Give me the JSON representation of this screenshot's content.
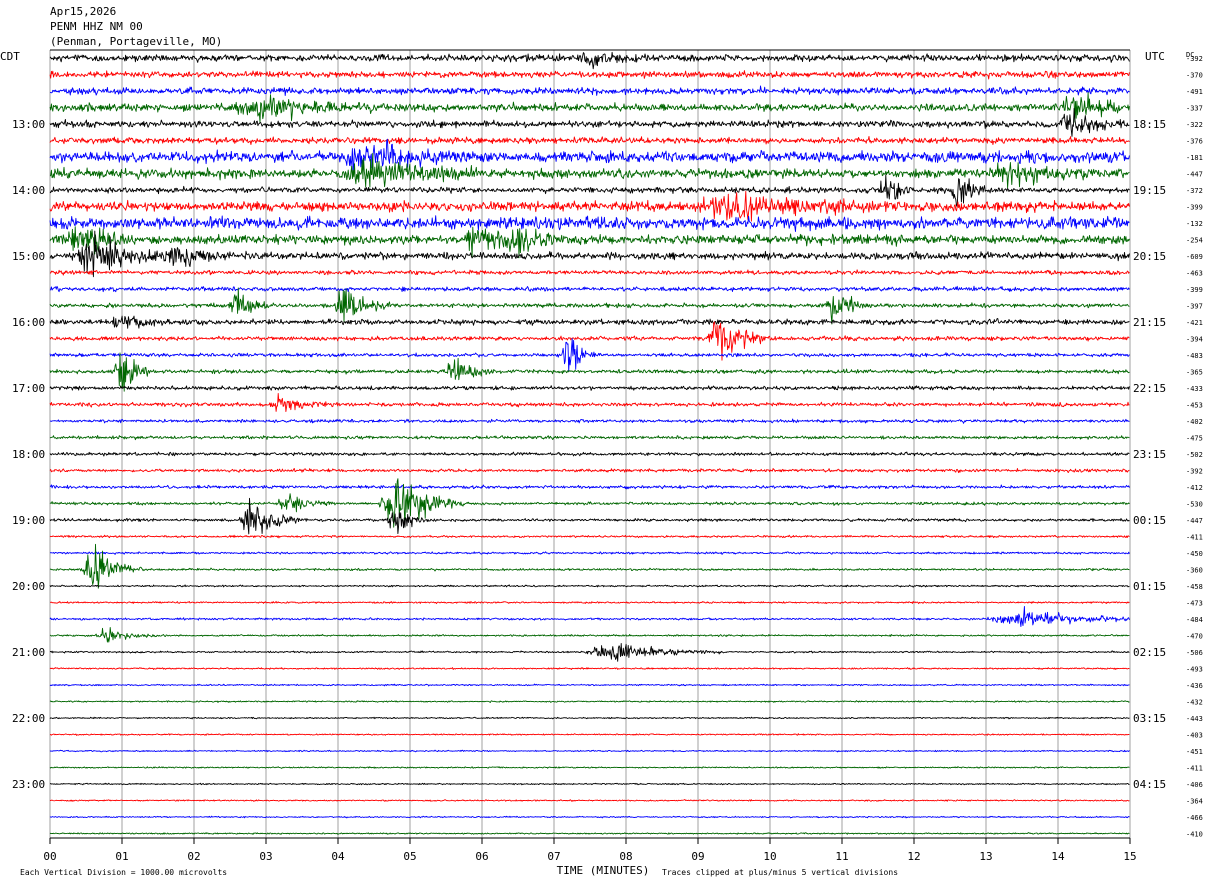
{
  "chart_data": {
    "type": "line",
    "header": {
      "date": "Apr15,2026",
      "station": "PENM HHZ NM 00",
      "location": "(Penman, Portageville, MO)"
    },
    "left_timezone": "CDT",
    "right_timezone": "UTC",
    "dc_label": "DC",
    "xlabel": "TIME (MINUTES)",
    "x_ticks": [
      "00",
      "01",
      "02",
      "03",
      "04",
      "05",
      "06",
      "07",
      "08",
      "09",
      "10",
      "11",
      "12",
      "13",
      "14",
      "15"
    ],
    "xlim": [
      0,
      15
    ],
    "minutes_per_trace": 15,
    "left_hour_labels": [
      "13:00",
      "14:00",
      "15:00",
      "16:00",
      "17:00",
      "18:00",
      "19:00",
      "20:00",
      "21:00",
      "22:00",
      "23:00"
    ],
    "right_hour_labels": [
      "18:15",
      "19:15",
      "20:15",
      "21:15",
      "22:15",
      "23:15",
      "00:15",
      "01:15",
      "02:15",
      "03:15",
      "04:15"
    ],
    "first_hour_label_trace_index": 4,
    "traces_per_hour": 4,
    "trace_colors": [
      "#000000",
      "#ff0000",
      "#0000ff",
      "#006600"
    ],
    "dc_offsets": [
      "-392",
      "-370",
      "-491",
      "-337",
      "-322",
      "-376",
      "-181",
      "-447",
      "-372",
      "-399",
      "-132",
      "-254",
      "-609",
      "-463",
      "-399",
      "-397",
      "-421",
      "-394",
      "-483",
      "-365",
      "-433",
      "-453",
      "-402",
      "-475",
      "-502",
      "-392",
      "-412",
      "-530",
      "-447",
      "-411",
      "-450",
      "-360",
      "-458",
      "-473",
      "-484",
      "-470",
      "-506",
      "-493",
      "-436",
      "-432",
      "-443",
      "-403",
      "-451",
      "-411",
      "-406",
      "-364",
      "-466",
      "-410"
    ],
    "trace_noise_level": [
      1.0,
      0.9,
      1.0,
      1.1,
      0.95,
      0.9,
      1.6,
      1.4,
      0.8,
      1.4,
      1.8,
      1.4,
      1.0,
      0.6,
      0.6,
      0.6,
      0.8,
      0.6,
      0.5,
      0.55,
      0.55,
      0.55,
      0.45,
      0.45,
      0.45,
      0.45,
      0.45,
      0.4,
      0.4,
      0.3,
      0.3,
      0.3,
      0.25,
      0.25,
      0.3,
      0.25,
      0.25,
      0.22,
      0.22,
      0.2,
      0.2,
      0.2,
      0.2,
      0.2,
      0.2,
      0.2,
      0.2,
      0.2
    ],
    "events": [
      {
        "trace": 0,
        "minute": 7.5,
        "amplitude": 1.2,
        "duration": 1.0
      },
      {
        "trace": 3,
        "minute": 3.0,
        "amplitude": 1.6,
        "duration": 2.5
      },
      {
        "trace": 3,
        "minute": 14.2,
        "amplitude": 2.0,
        "duration": 1.2
      },
      {
        "trace": 4,
        "minute": 14.2,
        "amplitude": 2.2,
        "duration": 1.0
      },
      {
        "trace": 6,
        "minute": 4.4,
        "amplitude": 2.0,
        "duration": 2.0
      },
      {
        "trace": 7,
        "minute": 4.4,
        "amplitude": 2.2,
        "duration": 2.0
      },
      {
        "trace": 7,
        "minute": 13.3,
        "amplitude": 1.8,
        "duration": 1.5
      },
      {
        "trace": 8,
        "minute": 11.6,
        "amplitude": 3.0,
        "duration": 0.5
      },
      {
        "trace": 8,
        "minute": 12.6,
        "amplitude": 2.8,
        "duration": 0.6
      },
      {
        "trace": 9,
        "minute": 9.5,
        "amplitude": 1.6,
        "duration": 3.0
      },
      {
        "trace": 11,
        "minute": 5.9,
        "amplitude": 2.6,
        "duration": 0.8
      },
      {
        "trace": 11,
        "minute": 6.5,
        "amplitude": 2.0,
        "duration": 0.8
      },
      {
        "trace": 11,
        "minute": 0.4,
        "amplitude": 2.4,
        "duration": 1.0
      },
      {
        "trace": 12,
        "minute": 0.6,
        "amplitude": 3.0,
        "duration": 1.5
      },
      {
        "trace": 12,
        "minute": 1.8,
        "amplitude": 1.6,
        "duration": 1.2
      },
      {
        "trace": 15,
        "minute": 2.6,
        "amplitude": 2.4,
        "duration": 0.6
      },
      {
        "trace": 15,
        "minute": 4.1,
        "amplitude": 3.4,
        "duration": 0.8
      },
      {
        "trace": 15,
        "minute": 10.9,
        "amplitude": 3.0,
        "duration": 0.6
      },
      {
        "trace": 16,
        "minute": 1.0,
        "amplitude": 1.4,
        "duration": 0.8
      },
      {
        "trace": 17,
        "minute": 9.3,
        "amplitude": 4.2,
        "duration": 0.9
      },
      {
        "trace": 18,
        "minute": 7.2,
        "amplitude": 4.4,
        "duration": 0.5
      },
      {
        "trace": 19,
        "minute": 1.0,
        "amplitude": 3.4,
        "duration": 0.6
      },
      {
        "trace": 19,
        "minute": 5.6,
        "amplitude": 3.8,
        "duration": 0.6
      },
      {
        "trace": 21,
        "minute": 3.2,
        "amplitude": 1.4,
        "duration": 1.0
      },
      {
        "trace": 27,
        "minute": 4.8,
        "amplitude": 6.0,
        "duration": 1.2
      },
      {
        "trace": 27,
        "minute": 3.3,
        "amplitude": 1.6,
        "duration": 0.8
      },
      {
        "trace": 28,
        "minute": 2.8,
        "amplitude": 3.8,
        "duration": 0.9
      },
      {
        "trace": 28,
        "minute": 4.8,
        "amplitude": 2.6,
        "duration": 0.6
      },
      {
        "trace": 31,
        "minute": 0.6,
        "amplitude": 3.2,
        "duration": 0.9
      },
      {
        "trace": 34,
        "minute": 13.5,
        "amplitude": 1.4,
        "duration": 2.5
      },
      {
        "trace": 35,
        "minute": 0.8,
        "amplitude": 1.3,
        "duration": 1.0
      },
      {
        "trace": 36,
        "minute": 7.8,
        "amplitude": 1.6,
        "duration": 2.0
      }
    ],
    "footer_left": "Each Vertical Division = 1000.00 microvolts",
    "footer_right": "Traces clipped at plus/minus 5 vertical divisions"
  }
}
